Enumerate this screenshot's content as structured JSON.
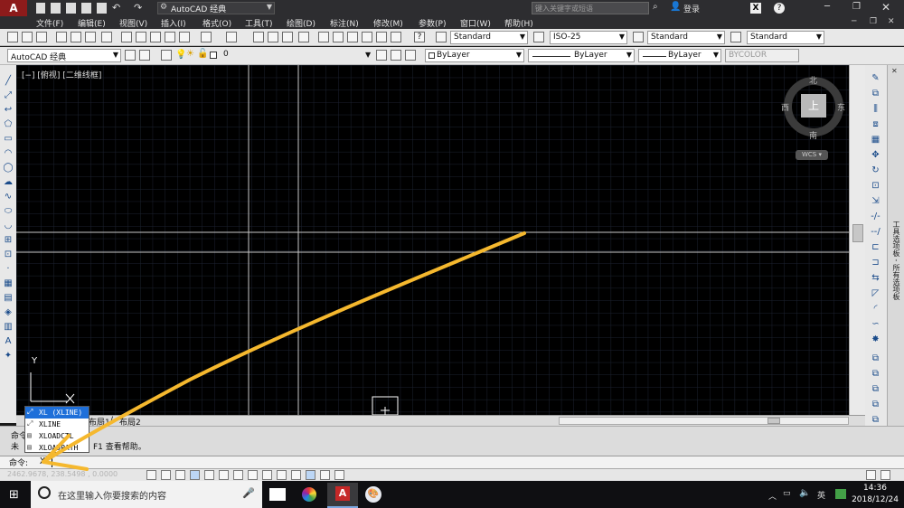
{
  "title_bar": {
    "workspace": "AutoCAD 经典",
    "search_placeholder": "键入关键字或短语",
    "login": "登录"
  },
  "menu": [
    "文件(F)",
    "编辑(E)",
    "视图(V)",
    "插入(I)",
    "格式(O)",
    "工具(T)",
    "绘图(D)",
    "标注(N)",
    "修改(M)",
    "参数(P)",
    "窗口(W)",
    "帮助(H)"
  ],
  "styles": {
    "text_style": "Standard",
    "dim_style": "ISO-25",
    "table_style": "Standard",
    "mleader_style": "Standard"
  },
  "layers": {
    "workspace": "AutoCAD 经典",
    "current_layer": "0",
    "color": "ByLayer",
    "linetype": "ByLayer",
    "lineweight": "ByLayer",
    "plotstyle": "BYCOLOR"
  },
  "viewport": {
    "label": "[−] [俯视] [二维线框]",
    "viewcube": {
      "north": "北",
      "south": "南",
      "east": "东",
      "west": "西",
      "top": "上",
      "wcs": "WCS"
    },
    "ucs_y": "Y"
  },
  "tabs": [
    "布局1",
    "布局2"
  ],
  "autocomplete": [
    "XL (XLINE)",
    "XLINE",
    "XLOADCTL",
    "XLOADPATH"
  ],
  "command_history": {
    "line1": "命令:",
    "line2": "未",
    "line2_tail": "F1 查看帮助。"
  },
  "command_line": {
    "prompt": "命令:",
    "input": "XL"
  },
  "status": {
    "coords": "2462.9678, 238.5498 , 0.0000"
  },
  "taskbar": {
    "search_placeholder": "在这里输入你要搜索的内容",
    "time": "14:36",
    "date": "2018/12/24"
  },
  "palette_label": "工具选项板 - 所有选项板",
  "colors": {
    "annotation_arrow": "#f5b82e",
    "canvas": "#000000",
    "grid": "#1c2230",
    "selected": "#1e6fd9"
  }
}
